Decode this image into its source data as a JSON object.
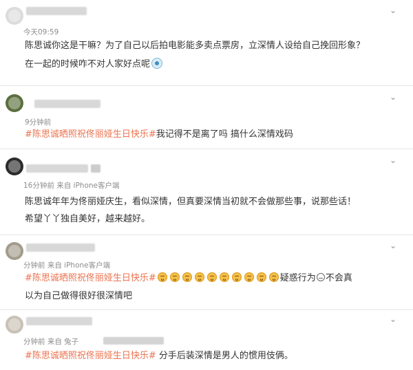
{
  "posts": [
    {
      "meta": "今天09:59",
      "lines": [
        [
          {
            "t": "text",
            "v": "陈思诚你这是干嘛？为了自己以后拍电影能多卖点票房，立深情人设给自己挽回形象？"
          }
        ],
        [
          {
            "t": "text",
            "v": "在一起的时候咋不对人家好点呢"
          },
          {
            "t": "sticker",
            "name": "sticker-icon"
          }
        ]
      ]
    },
    {
      "meta": "9分钟前",
      "lines": [
        [
          {
            "t": "hashtag",
            "v": "#陈思诚晒照祝佟丽娅生日快乐#"
          },
          {
            "t": "text",
            "v": "我记得不是离了吗 搞什么深情戏码"
          }
        ]
      ]
    },
    {
      "meta": "16分钟前  来自 iPhone客户端",
      "lines": [
        [
          {
            "t": "text",
            "v": "陈思诚年年为佟丽娅庆生，看似深情，但真要深情当初就不会做那些事，说那些话！"
          }
        ],
        [
          {
            "t": "text",
            "v": "希望丫丫独自美好，越来越好。"
          }
        ]
      ]
    },
    {
      "meta": "分钟前  来自 iPhone客户端",
      "lines": [
        [
          {
            "t": "hashtag",
            "v": "#陈思诚晒照祝佟丽娅生日快乐#"
          },
          {
            "t": "emoji",
            "count": 10
          },
          {
            "t": "text",
            "v": "疑惑行为"
          },
          {
            "t": "doubt"
          },
          {
            "t": "text",
            "v": "不会真"
          }
        ],
        [
          {
            "t": "text",
            "v": "以为自己做得很好很深情吧"
          }
        ]
      ]
    },
    {
      "meta": "分钟前  来自 兔子",
      "lines": [
        [
          {
            "t": "hashtag",
            "v": "#陈思诚晒照祝佟丽娅生日快乐#"
          },
          {
            "t": "text",
            "v": " 分手后装深情是男人的惯用伎俩。"
          }
        ]
      ]
    }
  ],
  "icons": {
    "chevron": "chevron-down-icon",
    "avatar": "avatar",
    "emoji": "emoji-icon",
    "doubt": "doubt-icon",
    "sticker": "sticker-icon"
  },
  "colors": {
    "hashtag": "#eb7350",
    "text": "#333333",
    "meta": "#8c8c8c"
  }
}
